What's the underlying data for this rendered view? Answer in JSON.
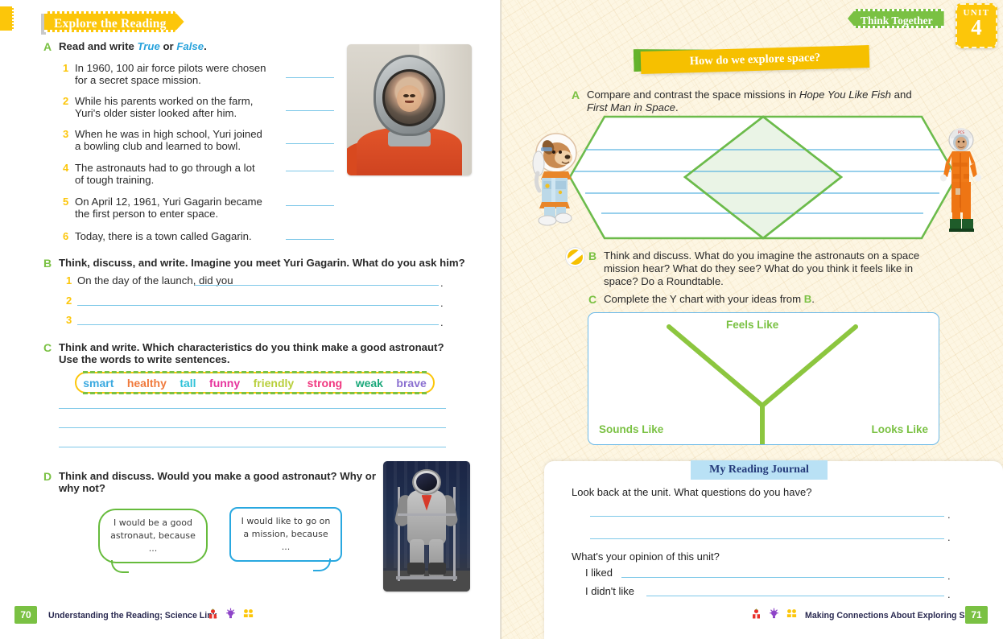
{
  "left_page": {
    "banner": "Explore the Reading",
    "exercise_a": {
      "letter": "A",
      "instruction_parts": [
        "Read and write ",
        "True",
        " or ",
        "False",
        "."
      ],
      "items": [
        {
          "num": "1",
          "line1": "In 1960, 100 air force pilots were chosen",
          "line2": "for a secret space mission."
        },
        {
          "num": "2",
          "line1": "While his parents worked on the farm,",
          "line2": "Yuri's older sister looked after him."
        },
        {
          "num": "3",
          "line1": "When he was in high school, Yuri joined",
          "line2": "a bowling club and learned to bowl."
        },
        {
          "num": "4",
          "line1": "The astronauts had to go through a lot",
          "line2": "of tough training."
        },
        {
          "num": "5",
          "line1": "On April 12, 1961, Yuri Gagarin became",
          "line2": "the first person to enter space."
        },
        {
          "num": "6",
          "line1": "Today, there is a town called Gagarin.",
          "line2": ""
        }
      ]
    },
    "exercise_b": {
      "letter": "B",
      "instruction": "Think, discuss, and write. Imagine you meet Yuri Gagarin. What do you ask him?",
      "items": [
        {
          "num": "1",
          "prompt": "On the day of the launch, did you",
          "period": "."
        },
        {
          "num": "2",
          "prompt": "",
          "period": "."
        },
        {
          "num": "3",
          "prompt": "",
          "period": "."
        }
      ]
    },
    "exercise_c": {
      "letter": "C",
      "line1": "Think and write. Which characteristics do you think make a good astronaut?",
      "line2": "Use the words to write sentences.",
      "words": [
        {
          "text": "smart",
          "color": "#3aa9e0"
        },
        {
          "text": "healthy",
          "color": "#f07a3c"
        },
        {
          "text": "tall",
          "color": "#2fc2d8"
        },
        {
          "text": "funny",
          "color": "#e6339c"
        },
        {
          "text": "friendly",
          "color": "#b8cf3c"
        },
        {
          "text": "strong",
          "color": "#f0377f"
        },
        {
          "text": "weak",
          "color": "#1aa87a"
        },
        {
          "text": "brave",
          "color": "#8a6fd0"
        }
      ]
    },
    "exercise_d": {
      "letter": "D",
      "line1": "Think and discuss. Would you make a good astronaut? Why or",
      "line2": "why not?",
      "bubbles": [
        {
          "line1": "I would be a good",
          "line2": "astronaut, because ...",
          "color": "#66bb3c"
        },
        {
          "line1": "I would like to go on",
          "line2": "a mission, because ...",
          "color": "#29a8e0"
        }
      ]
    },
    "images": {
      "gagarin_alt": "yuri-gagarin-photo",
      "spacesuit_alt": "spacesuit-on-stand-photo"
    },
    "footer": {
      "page_number": "70",
      "text": "Understanding the Reading; Science Link",
      "icons": [
        "person-red-icon",
        "lightbulb-purple-icon",
        "pair-yellow-icon"
      ]
    }
  },
  "right_page": {
    "banner_think": "Think Together",
    "unit": {
      "label": "UNIT",
      "number": "4"
    },
    "banner_question": "How do we explore space?",
    "exercise_a": {
      "letter": "A",
      "line1_pre": "Compare and contrast the space missions in ",
      "line1_italic1": "Hope You Like Fish",
      "line1_mid": " and",
      "line2_italic2": "First Man in Space",
      "line2_post": "."
    },
    "exercise_b": {
      "letter": "B",
      "icon": "lightning-bolt-icon",
      "line1": "Think and discuss. What do you imagine the astronauts on a space",
      "line2": "mission hear? What do they see? What do you think it feels like in",
      "line3": "space? Do a Roundtable."
    },
    "exercise_c": {
      "letter": "C",
      "text_pre": "Complete the Y chart with your ideas from ",
      "text_bold": "B",
      "text_post": "."
    },
    "ychart": {
      "top_label": "Feels Like",
      "left_label": "Sounds Like",
      "right_label": "Looks Like",
      "line_color": "#8cc63f",
      "border_color": "#6cb9e8"
    },
    "venn": {
      "outline_color": "#6cbb4b",
      "line_color": "#5ab4e0",
      "overlap_fill": "#eaf4e6"
    },
    "characters": {
      "left": "cartoon-dog-astronaut",
      "right": "orange-suit-astronaut"
    },
    "journal": {
      "title": "My Reading Journal",
      "q1": "Look back at the unit. What questions do you have?",
      "q2": "What's your opinion of this unit?",
      "sub1": "I liked",
      "sub2": "I didn't like",
      "period": "."
    },
    "footer": {
      "page_number": "71",
      "text": "Making Connections About Exploring Space",
      "icons": [
        "person-red-icon",
        "lightbulb-purple-icon",
        "pair-yellow-icon"
      ]
    }
  }
}
